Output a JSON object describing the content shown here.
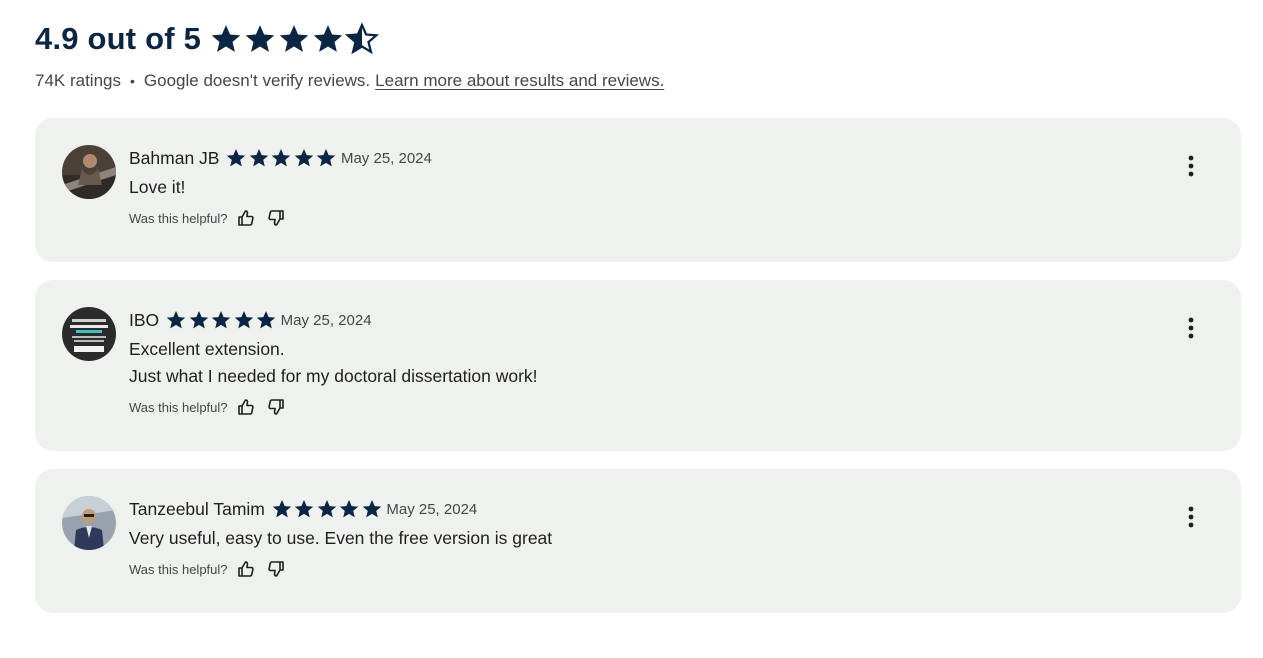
{
  "summary": {
    "rating_title": "4.9 out of 5",
    "rating_value": 4.9,
    "ratings_count": "74K ratings",
    "separator": "•",
    "disclaimer": "Google doesn't verify reviews.",
    "learn_more": "Learn more about results and reviews."
  },
  "colors": {
    "star": "#0b2545",
    "card_bg": "#eff1ee",
    "muted_text": "#444746"
  },
  "reviews": [
    {
      "name": "Bahman JB",
      "stars": 5,
      "date": "May 25, 2024",
      "lines": [
        "Love it!"
      ],
      "helpful_label": "Was this helpful?"
    },
    {
      "name": "IBO",
      "stars": 5,
      "date": "May 25, 2024",
      "lines": [
        "Excellent extension.",
        "Just what I needed for my doctoral dissertation work!"
      ],
      "helpful_label": "Was this helpful?"
    },
    {
      "name": "Tanzeebul Tamim",
      "stars": 5,
      "date": "May 25, 2024",
      "lines": [
        "Very useful, easy to use. Even the free version is great"
      ],
      "helpful_label": "Was this helpful?"
    }
  ],
  "icons": {
    "star": "star-icon",
    "thumb_up": "thumb-up-icon",
    "thumb_down": "thumb-down-icon",
    "more": "more-vert-icon"
  }
}
